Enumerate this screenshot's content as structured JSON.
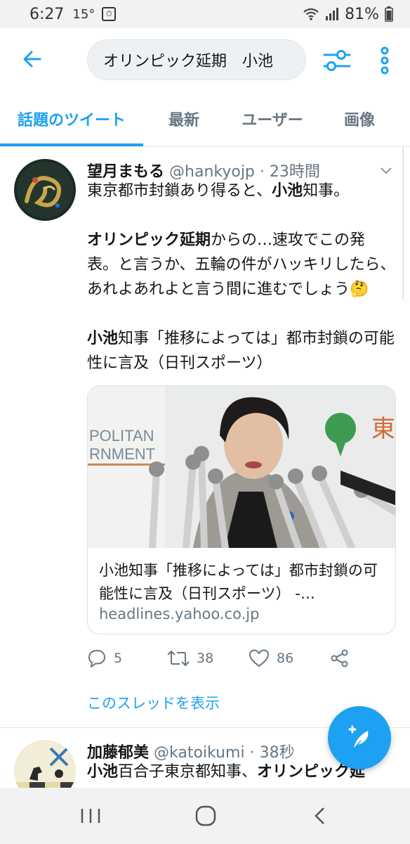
{
  "status_bar": {
    "time": "6:27",
    "temp": "15°",
    "battery": "81%",
    "icons": [
      "alarm-icon",
      "wifi-icon",
      "signal-icon",
      "battery-icon"
    ]
  },
  "search": {
    "query": "オリンピック延期　小池",
    "icons": [
      "back-arrow-icon",
      "filter-icon",
      "more-vert-icon"
    ]
  },
  "tabs": [
    {
      "label": "話題のツイート",
      "active": true
    },
    {
      "label": "最新",
      "active": false
    },
    {
      "label": "ユーザー",
      "active": false
    },
    {
      "label": "画像",
      "active": false
    }
  ],
  "tweet1": {
    "name": "望月まもる",
    "handle": "@hankyojp",
    "time": "· 23時間",
    "line1_a": "東京都市封鎖あり得ると、",
    "line1_b": "小池",
    "line1_c": "知事。",
    "para2_a": "オリンピック延期",
    "para2_b": "からの…速攻でこの発表。と言うか、五輪の件がハッキリしたら、あれよあれよと言う間に進むでしょう",
    "emoji": "🤔",
    "para3_a": "小池",
    "para3_b": "知事「推移によっては」都市封鎖の可能性に言及（日刊スポーツ）",
    "card": {
      "image_text_left1": "POLITAN",
      "image_text_left2": "RNMENT",
      "image_text_right": "東",
      "title": "小池知事「推移によっては」都市封鎖の可能性に言及（日刊スポーツ） -…",
      "domain": "headlines.yahoo.co.jp"
    },
    "replies": "5",
    "retweets": "38",
    "likes": "86",
    "show_thread": "このスレッドを表示"
  },
  "tweet2": {
    "name": "加藤郁美",
    "handle": "@katoikumi",
    "time": "· 38秒",
    "text_a": "小池",
    "text_b": "百合子東京都知事、",
    "text_c": "オリンピック延"
  },
  "colors": {
    "accent": "#1da1f2",
    "muted": "#657786"
  }
}
